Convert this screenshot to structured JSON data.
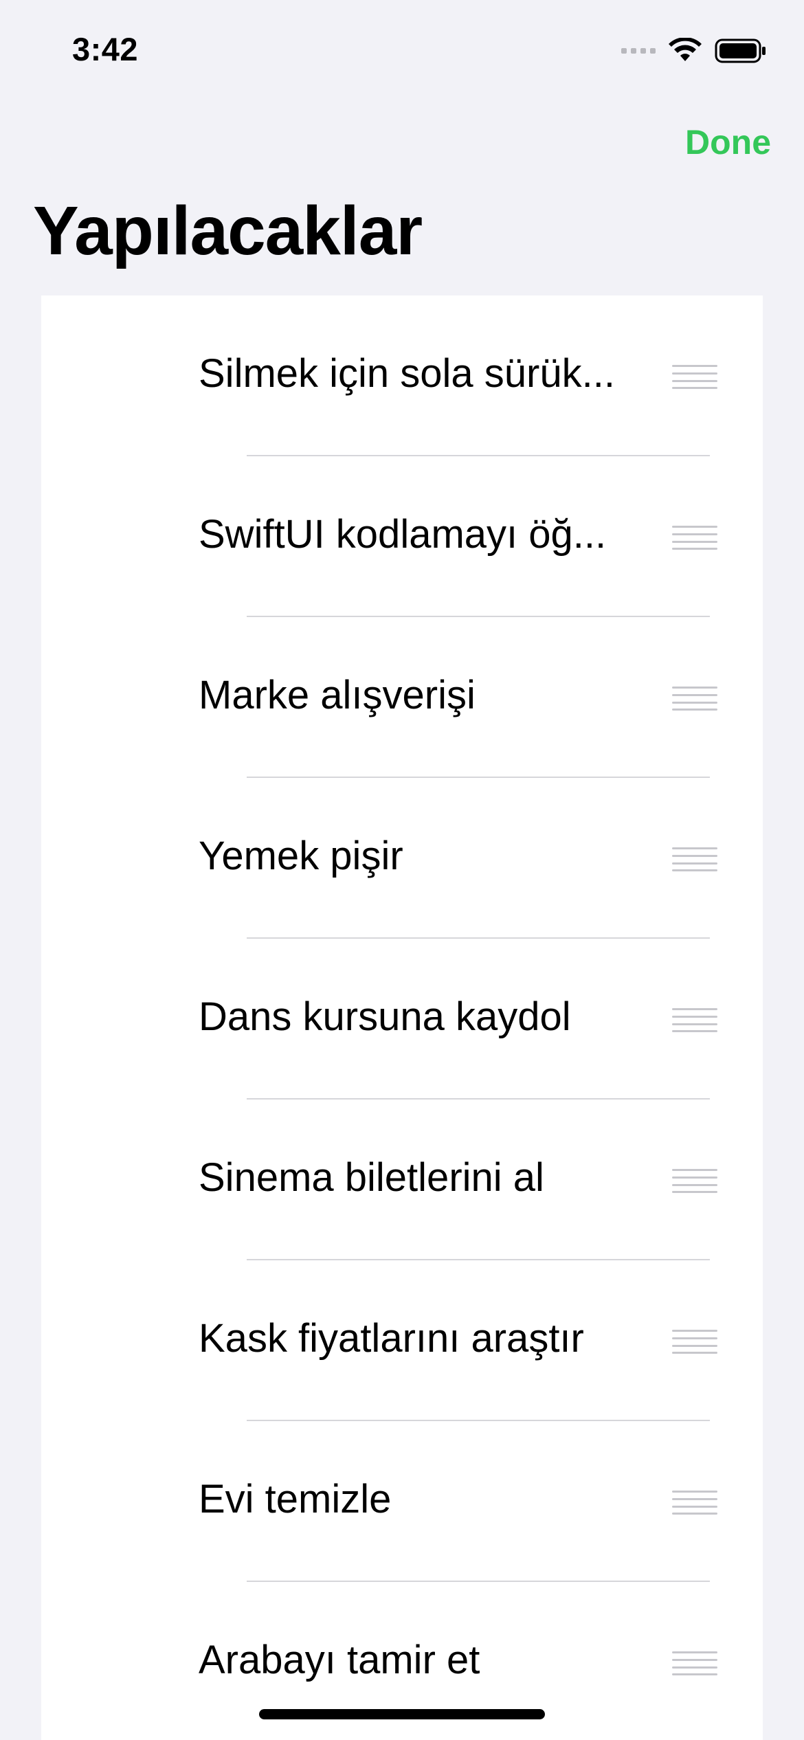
{
  "status_bar": {
    "time": "3:42",
    "icons": [
      "signal-icon",
      "wifi-icon",
      "battery-icon"
    ]
  },
  "nav": {
    "done_label": "Done",
    "done_color": "#34C759"
  },
  "page": {
    "title": "Yapılacaklar"
  },
  "todos": [
    {
      "label": "Silmek için sola sürük..."
    },
    {
      "label": "SwiftUI kodlamayı öğ..."
    },
    {
      "label": "Marke alışverişi"
    },
    {
      "label": "Yemek pişir"
    },
    {
      "label": "Dans kursuna kaydol"
    },
    {
      "label": "Sinema biletlerini al"
    },
    {
      "label": "Kask fiyatlarını araştır"
    },
    {
      "label": "Evi temizle"
    },
    {
      "label": "Arabayı tamir et"
    }
  ],
  "colors": {
    "background": "#F2F2F7",
    "card": "#FFFFFF",
    "accent": "#34C759",
    "handle": "#C7C7CC"
  }
}
